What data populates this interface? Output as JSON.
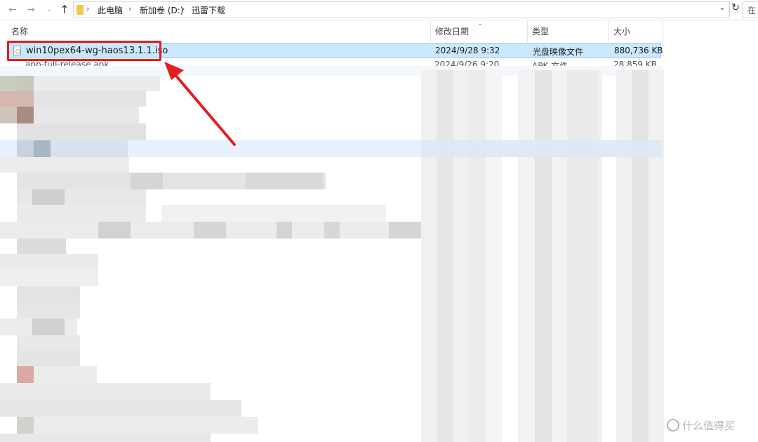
{
  "address_bar": {
    "crumbs": [
      "此电脑",
      "新加卷 (D:)",
      "迅雷下载"
    ],
    "search_placeholder": "在"
  },
  "columns": {
    "name": "名称",
    "modified": "修改日期",
    "type": "类型",
    "size": "大小"
  },
  "files": [
    {
      "name": "win10pex64-wg-haos13.1.1.iso",
      "modified": "2024/9/28 9:32",
      "type": "光盘映像文件",
      "size": "880,736 KB",
      "selected": true
    },
    {
      "name": "app-full-release.apk",
      "modified": "2024/9/26 9:20",
      "type": "APK 文件",
      "size": "28,859 KB",
      "selected": false
    }
  ],
  "watermark": "什么值得买",
  "colors": {
    "selection_bg": "#cce8ff",
    "annotation_red": "#e02020"
  }
}
